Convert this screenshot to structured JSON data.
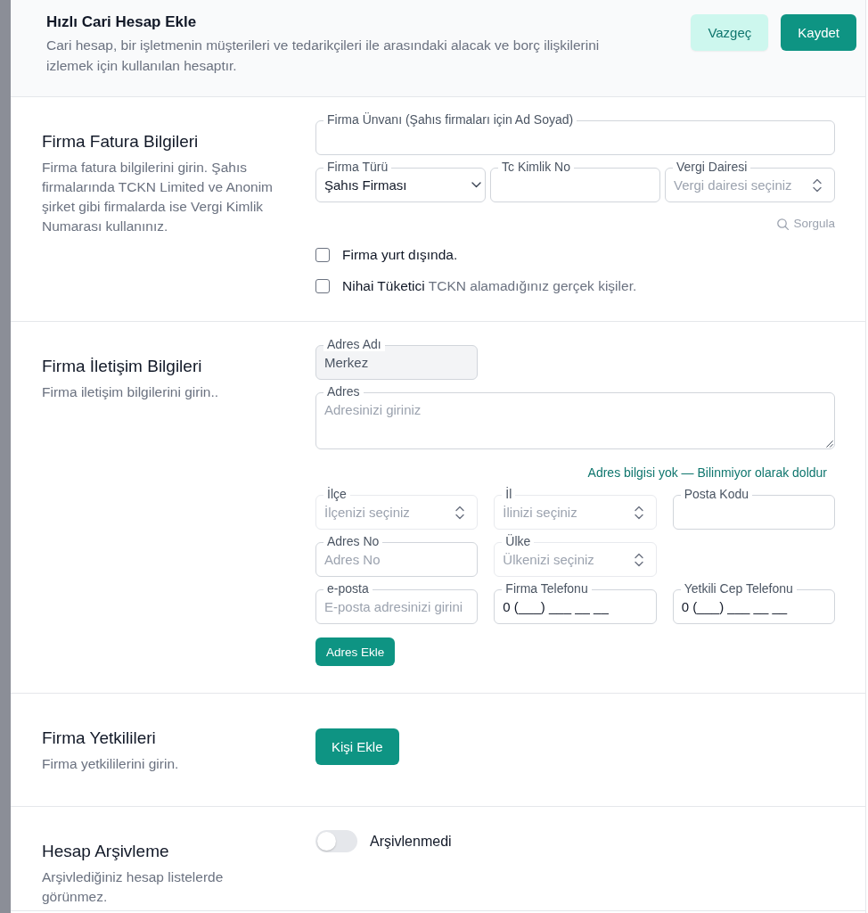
{
  "header": {
    "title": "Hızlı Cari Hesap Ekle",
    "description": "Cari hesap, bir işletmenin müşterileri ve tedarikçileri ile arasındaki alacak ve borç ilişkilerini izlemek için kullanılan hesaptır.",
    "buttons": [
      {
        "label": "Vazgeç",
        "kind": "secondary"
      },
      {
        "label": "Kaydet",
        "kind": "primary"
      }
    ]
  },
  "sections": [
    {
      "title": "Firma Fatura Bilgileri",
      "description": "Firma fatura bilgilerini girin. Şahıs firmalarında TCKN Limited ve Anonim şirket gibi firmalarda ise Vergi Kimlik Numarası kullanınız.",
      "blocks": [
        {
          "kind": "field-row",
          "fields": [
            {
              "kind": "wide-text",
              "label": "Firma Ünvanı (Şahıs firmaları için Ad Soyad)",
              "readonly": false,
              "disabled": false
            }
          ]
        },
        {
          "kind": "field-row",
          "fields": [
            {
              "kind": "select",
              "label": "Firma Türü",
              "value": "Şahıs Firması",
              "readonly": false,
              "disabled": false
            },
            {
              "kind": "text",
              "label": "Tc Kimlik No",
              "readonly": false,
              "disabled": false
            },
            {
              "kind": "combobox",
              "label": "Vergi Dairesi",
              "placeholder": "Vergi dairesi seçiniz",
              "readonly": false,
              "disabled": false
            }
          ]
        },
        {
          "kind": "lookup-link",
          "label": "Sorgula"
        },
        {
          "kind": "checkbox",
          "label": "Firma yurt dışında.",
          "checked": false
        },
        {
          "kind": "checkbox",
          "label": "Nihai Tüketici",
          "note": "TCKN alamadığınız gerçek kişiler.",
          "checked": false
        }
      ]
    },
    {
      "title": "Firma İletişim Bilgileri",
      "description": "Firma iletişim bilgilerini girin..",
      "blocks": [
        {
          "kind": "field-row",
          "fields": [
            {
              "kind": "text",
              "label": "Adres Adı",
              "value": "Merkez",
              "readonly": true,
              "disabled": false
            }
          ]
        },
        {
          "kind": "field-row",
          "fields": [
            {
              "kind": "textarea",
              "label": "Adres",
              "placeholder": "Adresinizi giriniz",
              "readonly": false,
              "disabled": false
            }
          ]
        },
        {
          "kind": "fill-link",
          "label": "Adres bilgisi yok — Bilinmiyor olarak doldur"
        },
        {
          "kind": "field-row",
          "fields": [
            {
              "kind": "combobox",
              "label": "İlçe",
              "placeholder": "İlçenizi seçiniz",
              "readonly": false,
              "disabled": true
            },
            {
              "kind": "combobox",
              "label": "İl",
              "placeholder": "İlinizi seçiniz",
              "readonly": false,
              "disabled": true
            },
            {
              "kind": "text",
              "label": "Posta Kodu",
              "readonly": false,
              "disabled": false
            }
          ]
        },
        {
          "kind": "field-row",
          "fields": [
            {
              "kind": "text",
              "label": "Adres No",
              "placeholder": "Adres No",
              "readonly": false,
              "disabled": false
            },
            {
              "kind": "combobox",
              "label": "Ülke",
              "placeholder": "Ülkenizi seçiniz",
              "readonly": false,
              "disabled": true
            }
          ]
        },
        {
          "kind": "field-row",
          "fields": [
            {
              "kind": "text",
              "label": "e-posta",
              "placeholder": "E-posta adresinizi girini",
              "readonly": false,
              "disabled": false
            },
            {
              "kind": "text",
              "label": "Firma Telefonu",
              "value": "0 (___) ___ __ __",
              "readonly": false,
              "disabled": false
            },
            {
              "kind": "text",
              "label": "Yetkili Cep Telefonu",
              "value": "0 (___) ___ __ __",
              "readonly": false,
              "disabled": false
            }
          ]
        },
        {
          "kind": "small-button",
          "label": "Adres Ekle"
        }
      ]
    },
    {
      "title": "Firma Yetkilileri",
      "description": "Firma yetkililerini girin.",
      "blocks": [
        {
          "kind": "button",
          "label": "Kişi Ekle"
        }
      ]
    },
    {
      "title": "Hesap Arşivleme",
      "description": "Arşivlediğiniz hesap listelerde görünmez.",
      "blocks": [
        {
          "kind": "toggle",
          "label": "Arşivlenmedi",
          "on": false
        }
      ]
    }
  ]
}
